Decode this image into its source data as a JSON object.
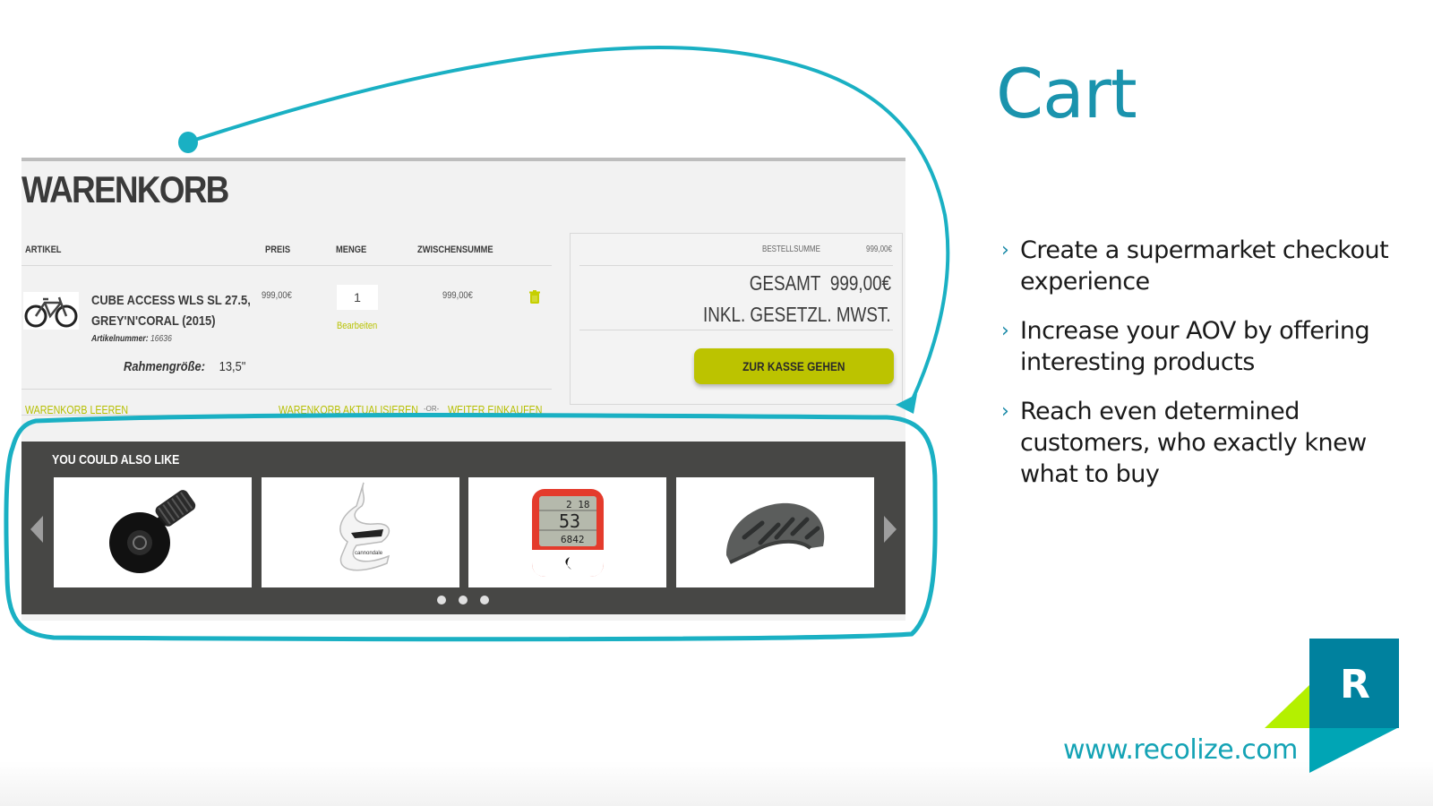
{
  "slide": {
    "title": "Cart",
    "bullets": [
      "Create a supermarket checkout experience",
      "Increase your AOV by offering interesting products",
      "Reach even determined customers, who exactly knew what to buy"
    ],
    "bullet_icon": "chevron-right-icon",
    "url": "www.recolize.com",
    "logo_letter": "R",
    "colors": {
      "accent": "#1a93ad",
      "url": "#14a3b5",
      "logo_dark": "#00819e",
      "logo_light": "#00a5b5",
      "logo_lime": "#b4f000",
      "annotation": "#1ab0c3"
    }
  },
  "shop": {
    "page_title": "WARENKORB",
    "columns": [
      "ARTIKEL",
      "PREIS",
      "MENGE",
      "ZWISCHENSUMME"
    ],
    "item": {
      "name_line1": "CUBE ACCESS WLS SL 27.5,",
      "name_line2": "GREY'N'CORAL (2015)",
      "article_label": "Artikelnummer:",
      "article_number": "16636",
      "size_label": "Rahmengröße:",
      "size_value": "13,5\"",
      "price": "999,00€",
      "quantity": "1",
      "edit_label": "Bearbeiten",
      "subtotal": "999,00€",
      "image_icon": "bicycle-icon",
      "delete_icon": "trash-icon"
    },
    "links": {
      "empty_cart": "WARENKORB LEEREN",
      "update_cart": "WARENKORB AKTUALISIEREN",
      "or": "-OR-",
      "continue": "WEITER EINKAUFEN"
    },
    "summary": {
      "order_total_label": "BESTELLSUMME",
      "order_total_value": "999,00€",
      "grand_total_label": "GESAMT",
      "grand_total_value": "999,00€",
      "tax_note": "INKL. GESETZL. MWST.",
      "checkout_label": "ZUR KASSE GEHEN"
    },
    "colors": {
      "lime": "#bcc300",
      "dark_panel": "#474745"
    },
    "recommendations": {
      "title": "YOU COULD ALSO LIKE",
      "items": [
        {
          "icon": "bike-bell-icon"
        },
        {
          "icon": "bottle-cage-icon"
        },
        {
          "icon": "bike-computer-icon",
          "display_top": "2 18",
          "display_mid": "53",
          "display_bot": "6842"
        },
        {
          "icon": "bike-helmet-icon"
        }
      ],
      "page_count": 3
    }
  }
}
